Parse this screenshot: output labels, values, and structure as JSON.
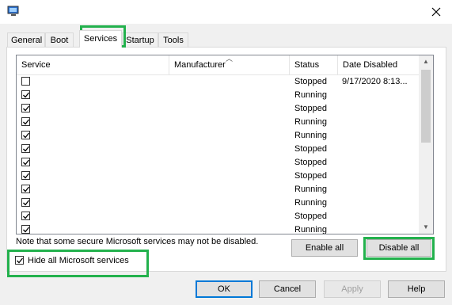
{
  "tabs": [
    {
      "label": "General"
    },
    {
      "label": "Boot"
    },
    {
      "label": "Services"
    },
    {
      "label": "Startup"
    },
    {
      "label": "Tools"
    }
  ],
  "active_tab": "Services",
  "columns": [
    "Service",
    "Manufacturer",
    "Status",
    "Date Disabled"
  ],
  "rows": [
    {
      "checked": false,
      "service": "",
      "manufacturer": "",
      "status": "Stopped",
      "date_disabled": "9/17/2020 8:13..."
    },
    {
      "checked": true,
      "service": "",
      "manufacturer": "",
      "status": "Running",
      "date_disabled": ""
    },
    {
      "checked": true,
      "service": "",
      "manufacturer": "",
      "status": "Stopped",
      "date_disabled": ""
    },
    {
      "checked": true,
      "service": "",
      "manufacturer": "",
      "status": "Running",
      "date_disabled": ""
    },
    {
      "checked": true,
      "service": "",
      "manufacturer": "",
      "status": "Running",
      "date_disabled": ""
    },
    {
      "checked": true,
      "service": "",
      "manufacturer": "",
      "status": "Stopped",
      "date_disabled": ""
    },
    {
      "checked": true,
      "service": "",
      "manufacturer": "",
      "status": "Stopped",
      "date_disabled": ""
    },
    {
      "checked": true,
      "service": "",
      "manufacturer": "",
      "status": "Stopped",
      "date_disabled": ""
    },
    {
      "checked": true,
      "service": "",
      "manufacturer": "",
      "status": "Running",
      "date_disabled": ""
    },
    {
      "checked": true,
      "service": "",
      "manufacturer": "",
      "status": "Running",
      "date_disabled": ""
    },
    {
      "checked": true,
      "service": "",
      "manufacturer": "",
      "status": "Stopped",
      "date_disabled": ""
    },
    {
      "checked": true,
      "service": "",
      "manufacturer": "",
      "status": "Running",
      "date_disabled": ""
    }
  ],
  "note": "Note that some secure Microsoft services may not be disabled.",
  "enable_all_label": "Enable all",
  "disable_all_label": "Disable all",
  "hide_ms_label": "Hide all Microsoft services",
  "hide_ms_checked": true,
  "buttons": {
    "ok": "OK",
    "cancel": "Cancel",
    "apply": "Apply",
    "help": "Help"
  },
  "highlight_color": "#23b14d",
  "icons": {
    "app": "system-configuration-icon",
    "close": "close-icon",
    "sort": "sort-ascending-icon"
  }
}
